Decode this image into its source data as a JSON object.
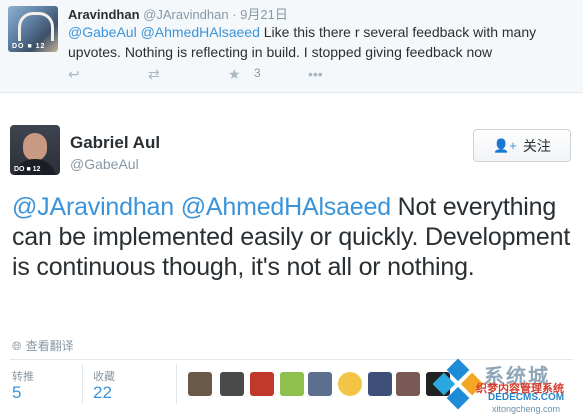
{
  "reply": {
    "author_name": "Aravindhan",
    "author_handle": "@JAravindhan",
    "date": "· 9月21日",
    "mention1": "@GabeAul",
    "mention2": "@AhmedHAlsaeed",
    "text": " Like this there r several feedback with many upvotes. Nothing is reflecting in build. I stopped giving feedback now",
    "favorite_count": "3",
    "avatar_tag": "DO ■ 12"
  },
  "tweet": {
    "author_name": "Gabriel Aul",
    "author_handle": "@GabeAul",
    "follow_label": "关注",
    "mention1": "@JAravindhan",
    "mention2": "@AhmedHAlsaeed",
    "text": " Not everything can be implemented easily or quickly. Development is continuous though, it's not all or nothing.",
    "translate_label": "查看翻译",
    "avatar_tag": "DO ■ 12"
  },
  "stats": {
    "retweets_label": "转推",
    "retweets_count": "5",
    "favorites_label": "收藏",
    "favorites_count": "22"
  },
  "watermark": {
    "line1": "系统城",
    "line2": "织梦内容管理系统",
    "line3": "DEDECMS.COM",
    "line4": "xitongcheng.com"
  },
  "colors": {
    "link": "#3b94d9",
    "muted": "#8899a6",
    "text": "#292f33"
  },
  "icons": [
    "reply-icon",
    "retweet-icon",
    "favorite-icon",
    "more-icon",
    "follow-person-icon",
    "globe-icon"
  ]
}
